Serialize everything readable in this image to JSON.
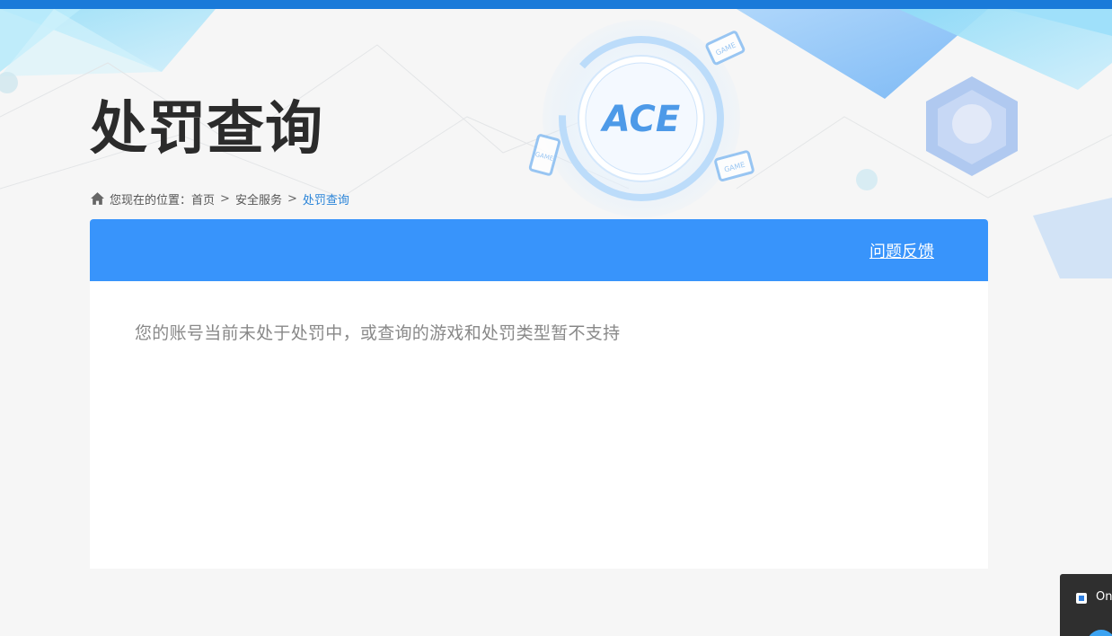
{
  "header": {
    "title": "处罚查询",
    "logo_text": "ACE",
    "game_badge_text": "GAME"
  },
  "breadcrumb": {
    "prefix": "您现在的位置：",
    "items": [
      {
        "label": "首页"
      },
      {
        "label": "安全服务"
      }
    ],
    "separator": ">",
    "current": "处罚查询"
  },
  "panel": {
    "feedback_label": "问题反馈",
    "message": "您的账号当前未处于处罚中，或查询的游戏和处罚类型暂不支持"
  },
  "popup": {
    "text": "On"
  },
  "colors": {
    "top_bar": "#1a7ad9",
    "panel_header": "#3894fb",
    "breadcrumb_current": "#2a84d8"
  }
}
